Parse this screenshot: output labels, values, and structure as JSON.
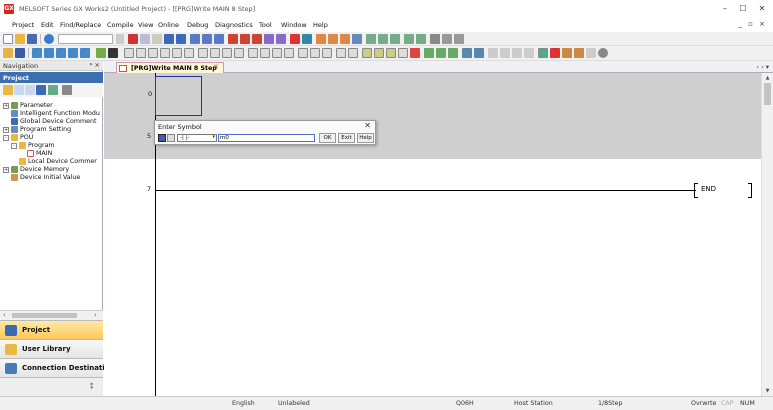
{
  "window": {
    "title": "MELSOFT Series GX Works2 (Untitled Project) - [[PRG]Write MAIN 8 Step]",
    "app_icon": "GX",
    "controls": [
      "–",
      "☐",
      "✕"
    ]
  },
  "menu": {
    "items": [
      "Project",
      "Edit",
      "Find/Replace",
      "Compile",
      "View",
      "Online",
      "Debug",
      "Diagnostics",
      "Tool",
      "Window",
      "Help"
    ],
    "right_controls": "_ ▫ ×"
  },
  "navigation": {
    "title": "Navigation",
    "header_controls": "ᵖ ×",
    "section": "Project",
    "tree": [
      {
        "label": "Parameter",
        "level": 0,
        "expander": "+"
      },
      {
        "label": "Intelligent Function Modu",
        "level": 0,
        "expander": ""
      },
      {
        "label": "Global Device Comment",
        "level": 0,
        "expander": ""
      },
      {
        "label": "Program Setting",
        "level": 0,
        "expander": "+"
      },
      {
        "label": "POU",
        "level": 0,
        "expander": "-"
      },
      {
        "label": "Program",
        "level": 1,
        "expander": "-"
      },
      {
        "label": "MAIN",
        "level": 2,
        "expander": ""
      },
      {
        "label": "Local Device Commer",
        "level": 1,
        "expander": ""
      },
      {
        "label": "Device Memory",
        "level": 0,
        "expander": "+"
      },
      {
        "label": "Device Initial Value",
        "level": 0,
        "expander": ""
      }
    ],
    "buttons": [
      "Project",
      "User Library",
      "Connection Destination"
    ],
    "scroll_left": "‹",
    "scroll_right": "›",
    "bottom_grip": "⁑"
  },
  "editor": {
    "tab_label": "[PRG]Write MAIN 8 Step",
    "tab_close": "✕",
    "tab_arrows": "‹ › ▾",
    "steps": [
      "0",
      "5",
      "7"
    ],
    "end_label": "END",
    "scroll_up": "▲",
    "scroll_down": "▼"
  },
  "dialog": {
    "title": "Enter Symbol",
    "close": "✕",
    "selected_symbol": "-| |-",
    "select_arrow": "▾",
    "input_value": "m0",
    "ok_label": "OK",
    "exit_label": "Exit",
    "help_label": "Help"
  },
  "status": {
    "language": "English",
    "label_state": "Unlabeled",
    "cpu": "Q06H",
    "connection": "Host Station",
    "steps": "1/8Step",
    "mode": "Ovrwrte",
    "cap": "CAP",
    "num": "NUM"
  }
}
